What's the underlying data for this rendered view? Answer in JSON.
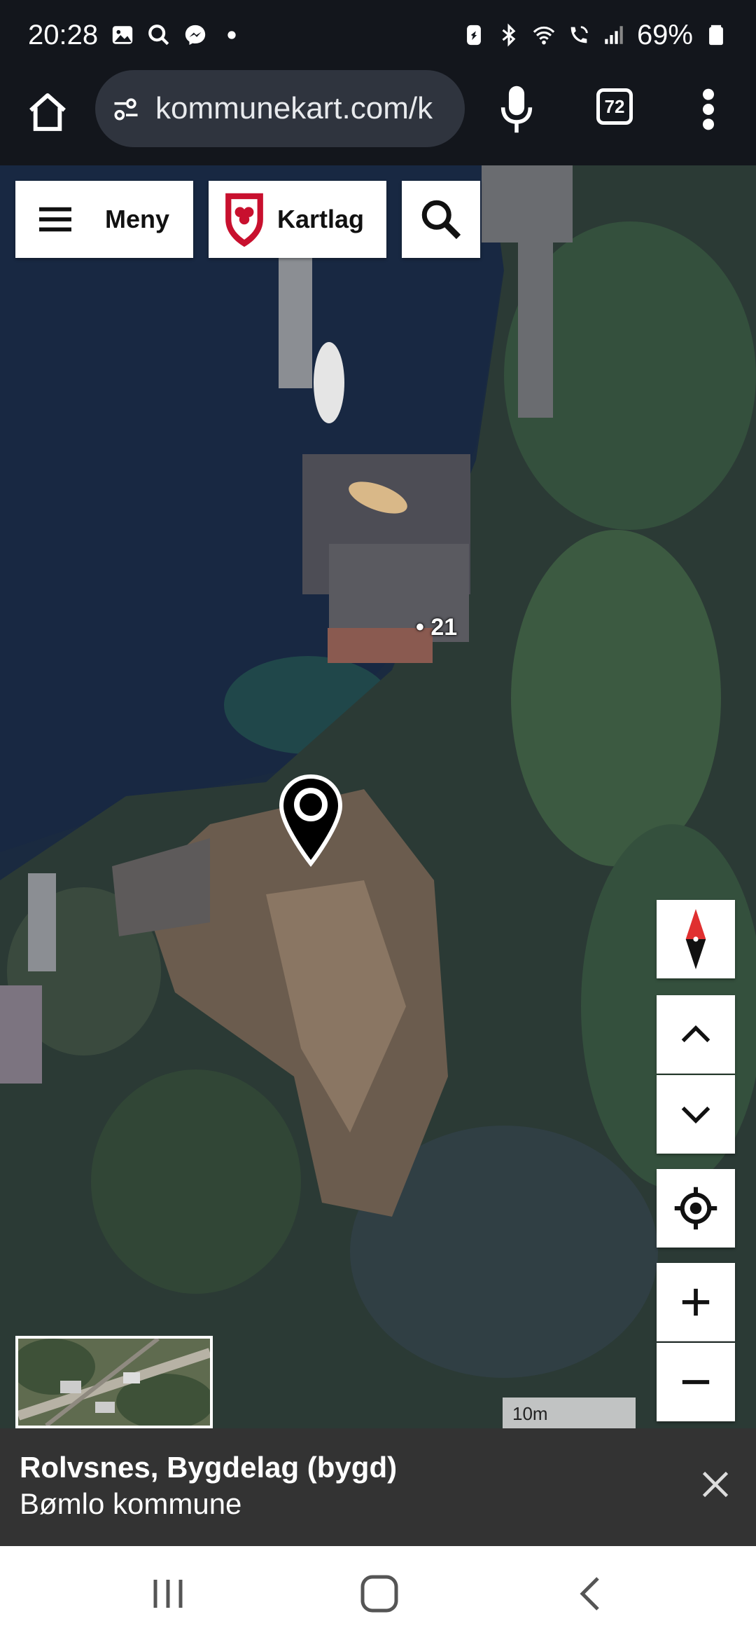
{
  "status_bar": {
    "time": "20:28",
    "battery": "69%",
    "left_icons": [
      "gallery-icon",
      "search-icon",
      "messenger-icon",
      "dot-icon"
    ],
    "right_icons": [
      "battery-saver-icon",
      "bluetooth-icon",
      "wifi-icon",
      "wifi-calling-icon",
      "signal-icon",
      "battery-icon"
    ]
  },
  "browser": {
    "url": "kommunekart.com/k",
    "tab_count": "72"
  },
  "map_toolbar": {
    "menu_label": "Meny",
    "layers_label": "Kartlag"
  },
  "map": {
    "address_label": "• 21",
    "scale_label": "10m"
  },
  "info_panel": {
    "title": "Rolvsnes, Bygdelag (bygd)",
    "subtitle": "Bømlo kommune"
  },
  "colors": {
    "status_bg": "#13161c",
    "url_bg": "#2f343e",
    "panel_bg": "#333333",
    "compass_red": "#e03030",
    "crest_red": "#c8102e"
  }
}
